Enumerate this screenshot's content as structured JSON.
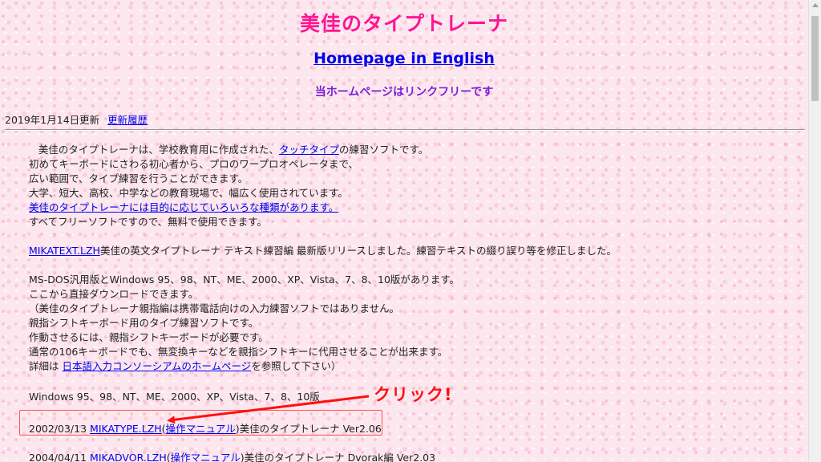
{
  "header": {
    "title": "美佳のタイプトレーナ",
    "english_link": "Homepage in English",
    "link_free": "当ホームページはリンクフリーです"
  },
  "update": {
    "date": "2019年1月14日更新",
    "history_link": "更新履歴"
  },
  "intro": {
    "line1_before": "美佳のタイプトレーナは、学校教育用に作成された、",
    "line1_link": "タッチタイプ",
    "line1_after": "の練習ソフトです。",
    "line2": "初めてキーボードにさわる初心者から、プロのワープロオペレータまで、",
    "line3": "広い範囲で、タイプ練習を行うことができます。",
    "line4": "大学、短大、高校、中学などの教育現場で、幅広く使用されています。",
    "line5_link": "美佳のタイプトレーナには目的に応じていろいろな種類があります。",
    "line6": "すべてフリーソフトですので、無料で使用できます。"
  },
  "news": {
    "link": "MIKATEXT.LZH",
    "text": "美佳の英文タイプトレーナ テキスト練習編 最新版リリースしました。練習テキストの綴り誤り等を修正しました。"
  },
  "versions": {
    "line1": "MS-DOS汎用版とWindows 95、98、NT、ME、2000、XP、Vista、7、8、10版があります。",
    "line2": "ここから直接ダウンロードできます。",
    "line3": "（美佳のタイプトレーナ親指編は携帯電話向けの入力練習ソフトではありません。",
    "line4": "親指シフトキーボード用のタイプ練習ソフトです。",
    "line5": "作動させるには、親指シフトキーボードが必要です。",
    "line6": "通常の106キーボードでも、無変換キーなどを親指シフトキーに代用させることが出来ます。",
    "line7_before": "詳細は ",
    "line7_link": "日本語入力コンソーシアムのホームページ",
    "line7_after": "を参照して下さい）"
  },
  "downloads": {
    "os_heading": "Windows 95、98、NT、ME、2000、XP、Vista、7、8、10版",
    "item1": {
      "date": "2002/03/13 ",
      "file_link": "MIKATYPE.LZH",
      "paren_open": "(",
      "manual_link": "操作マニュアル",
      "paren_close": ")",
      "description": "美佳のタイプトレーナ Ver2.06"
    },
    "item2": {
      "date": "2004/04/11 ",
      "file_link": "MIKADVOR.LZH",
      "paren_open": "(",
      "manual_link": "操作マニュアル",
      "paren_close": ")",
      "description": "美佳のタイプトレーナ Dvorak編 Ver2.03"
    }
  },
  "annotation": {
    "callout": "クリック!",
    "color": "#ff1010"
  }
}
